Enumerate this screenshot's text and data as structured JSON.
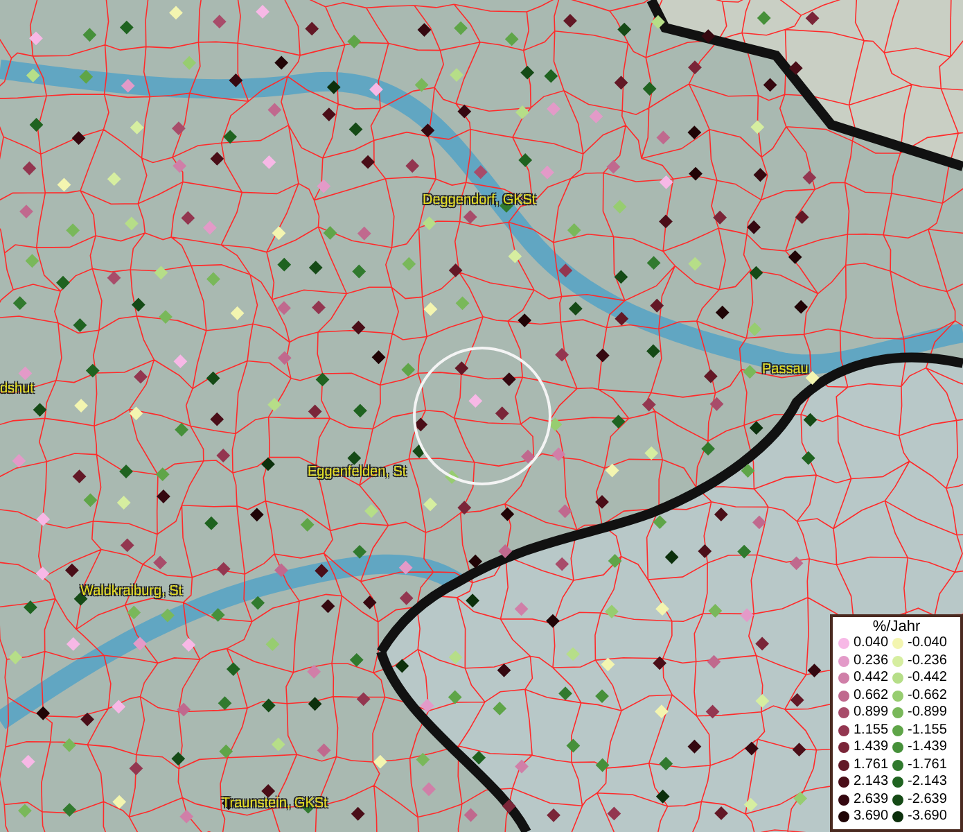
{
  "map": {
    "places": [
      {
        "name": "Deggendorf, GKSt"
      },
      {
        "name": "Passau"
      },
      {
        "name": "dshut"
      },
      {
        "name": "Eggenfelden, St"
      },
      {
        "name": "Waldkraiburg, St"
      },
      {
        "name": "Traunstein, GKSt"
      }
    ]
  },
  "legend": {
    "title": "%/Jahr",
    "columns": [
      [
        {
          "label": "0.040",
          "color": "#f7b8e6"
        },
        {
          "label": "0.236",
          "color": "#e39ac8"
        },
        {
          "label": "0.442",
          "color": "#d07fa8"
        },
        {
          "label": "0.662",
          "color": "#c0698e"
        },
        {
          "label": "0.899",
          "color": "#a84c6a"
        },
        {
          "label": "1.155",
          "color": "#933650"
        },
        {
          "label": "1.439",
          "color": "#7a2538"
        },
        {
          "label": "1.761",
          "color": "#631826"
        },
        {
          "label": "2.143",
          "color": "#4a0e18"
        },
        {
          "label": "2.639",
          "color": "#350810"
        },
        {
          "label": "3.690",
          "color": "#200406"
        }
      ],
      [
        {
          "label": "-0.040",
          "color": "#f3f5b0"
        },
        {
          "label": "-0.236",
          "color": "#d6eea0"
        },
        {
          "label": "-0.442",
          "color": "#b6de88"
        },
        {
          "label": "-0.662",
          "color": "#97cd70"
        },
        {
          "label": "-0.899",
          "color": "#79b85a"
        },
        {
          "label": "-1.155",
          "color": "#5fa548"
        },
        {
          "label": "-1.439",
          "color": "#46903a"
        },
        {
          "label": "-1.761",
          "color": "#317a2e"
        },
        {
          "label": "-2.143",
          "color": "#1f6320"
        },
        {
          "label": "-2.639",
          "color": "#154a16"
        },
        {
          "label": "-3.690",
          "color": "#0c300c"
        }
      ]
    ]
  }
}
